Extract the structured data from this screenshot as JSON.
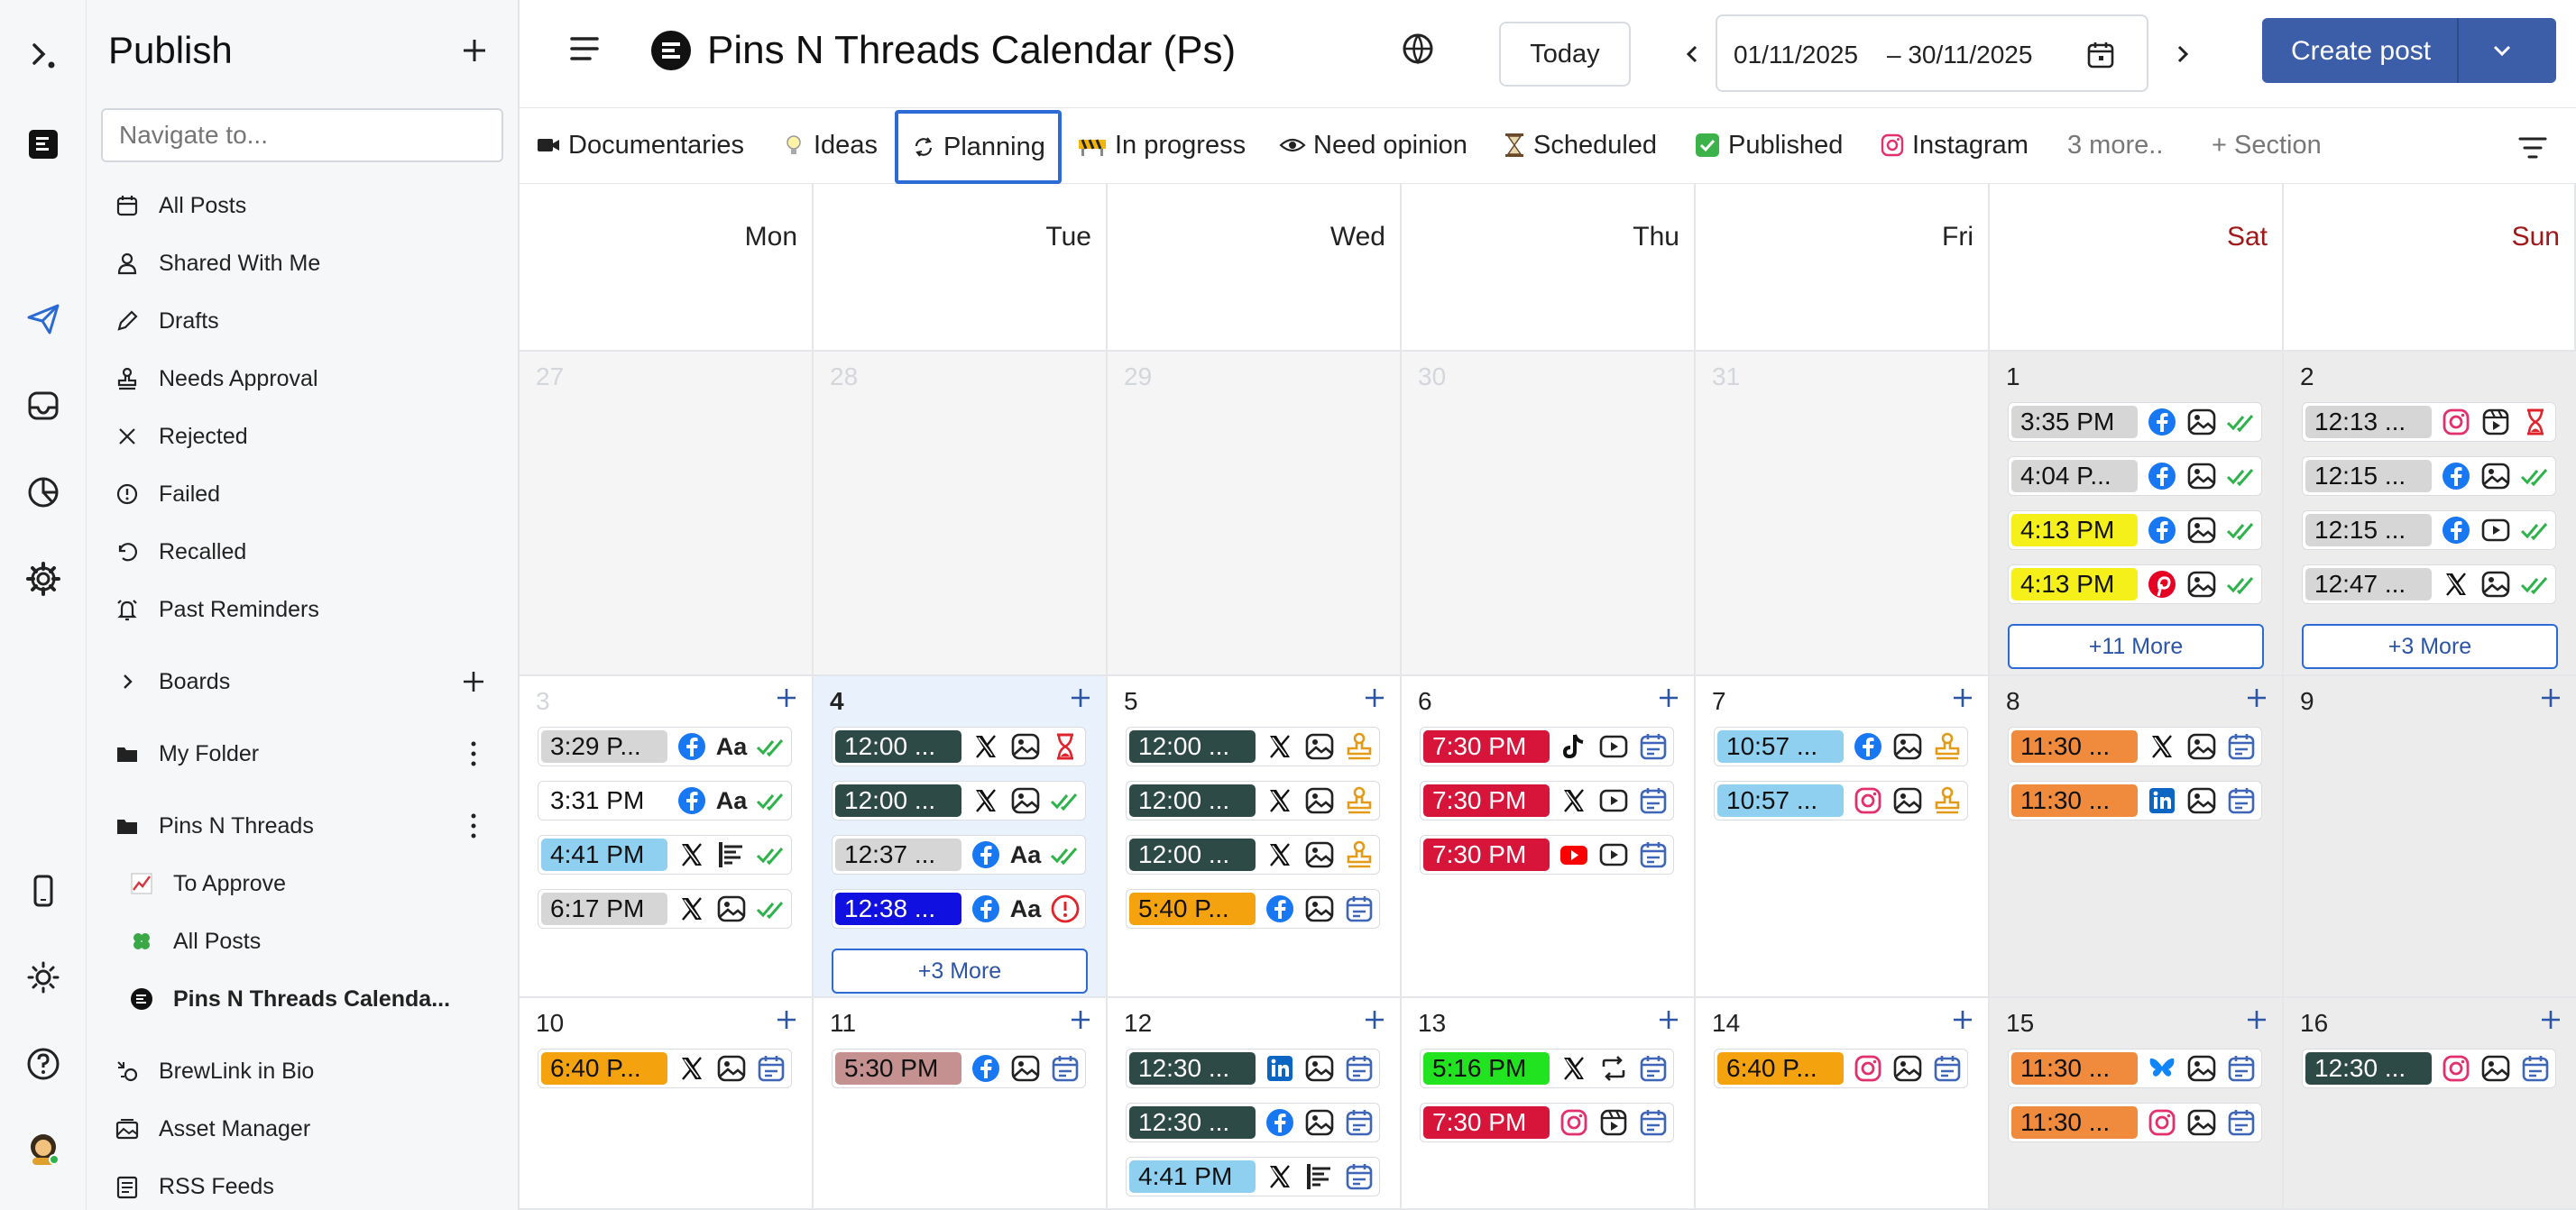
{
  "colors": {
    "accent": "#3c5ea8",
    "tab_active_border": "#2c6bd6",
    "weekend_text": "#a01818",
    "today_bg": "#e8f1fc"
  },
  "sidebar": {
    "title": "Publish",
    "search_placeholder": "Navigate to...",
    "items": [
      {
        "label": "All Posts",
        "icon": "calendar-icon"
      },
      {
        "label": "Shared With Me",
        "icon": "user-icon"
      },
      {
        "label": "Drafts",
        "icon": "pencil-icon"
      },
      {
        "label": "Needs Approval",
        "icon": "stamp-icon"
      },
      {
        "label": "Rejected",
        "icon": "close-icon"
      },
      {
        "label": "Failed",
        "icon": "alert-icon"
      },
      {
        "label": "Recalled",
        "icon": "undo-icon"
      },
      {
        "label": "Past Reminders",
        "icon": "alarm-icon"
      }
    ],
    "boards_label": "Boards",
    "folders": [
      {
        "label": "My Folder"
      },
      {
        "label": "Pins N Threads"
      }
    ],
    "subitems": [
      {
        "label": "To Approve",
        "icon": "chart-emoji-icon"
      },
      {
        "label": "All Posts",
        "icon": "clover-emoji-icon"
      },
      {
        "label": "Pins N Threads Calenda...",
        "icon": "brand-logo-icon"
      }
    ],
    "bottom": [
      {
        "label": "BrewLink in Bio",
        "icon": "link-bio-icon"
      },
      {
        "label": "Asset Manager",
        "icon": "image-icon"
      },
      {
        "label": "RSS Feeds",
        "icon": "rss-icon"
      }
    ]
  },
  "header": {
    "title": "Pins N Threads Calendar (Ps)",
    "today": "Today",
    "date_from": "01/11/2025",
    "date_to": "– 30/11/2025",
    "create": "Create post"
  },
  "tabs": [
    {
      "label": "Documentaries",
      "icon": "video-camera-icon"
    },
    {
      "label": "Ideas",
      "icon": "bulb-icon"
    },
    {
      "label": "Planning",
      "icon": "refresh-icon",
      "active": true
    },
    {
      "label": "In progress",
      "icon": "construction-icon"
    },
    {
      "label": "Need opinion",
      "icon": "eye-icon"
    },
    {
      "label": "Scheduled",
      "icon": "hourglass-icon"
    },
    {
      "label": "Published",
      "icon": "check-box-icon"
    },
    {
      "label": "Instagram",
      "icon": "instagram-icon"
    },
    {
      "label": "3 more..",
      "icon": ""
    },
    {
      "label": "+ Section",
      "icon": ""
    }
  ],
  "calendar": {
    "weekdays": [
      "Mon",
      "Tue",
      "Wed",
      "Thu",
      "Fri",
      "Sat",
      "Sun"
    ],
    "weeks": [
      {
        "days": [
          {
            "num": "27",
            "posts": []
          },
          {
            "num": "28",
            "posts": []
          },
          {
            "num": "29",
            "posts": []
          },
          {
            "num": "30",
            "posts": []
          },
          {
            "num": "31",
            "posts": []
          },
          {
            "num": "1",
            "posts": [
              {
                "time": "3:35 PM",
                "bg": "#d6d6d6",
                "fg": "#111",
                "icons": [
                  "facebook",
                  "image",
                  "check"
                ]
              },
              {
                "time": "4:04 P...",
                "bg": "#d6d6d6",
                "fg": "#111",
                "icons": [
                  "facebook",
                  "image",
                  "check"
                ]
              },
              {
                "time": "4:13 PM",
                "bg": "#f5ef1a",
                "fg": "#111",
                "icons": [
                  "facebook",
                  "image",
                  "check"
                ]
              },
              {
                "time": "4:13 PM",
                "bg": "#f5ef1a",
                "fg": "#111",
                "icons": [
                  "pinterest",
                  "image",
                  "check"
                ]
              }
            ],
            "more": "+11 More"
          },
          {
            "num": "2",
            "posts": [
              {
                "time": "12:13 ...",
                "bg": "#d6d6d6",
                "fg": "#111",
                "icons": [
                  "instagram",
                  "reel",
                  "hourglass"
                ]
              },
              {
                "time": "12:15 ...",
                "bg": "#d6d6d6",
                "fg": "#111",
                "icons": [
                  "facebook",
                  "image",
                  "check"
                ]
              },
              {
                "time": "12:15 ...",
                "bg": "#d6d6d6",
                "fg": "#111",
                "icons": [
                  "facebook",
                  "video",
                  "check"
                ]
              },
              {
                "time": "12:47 ...",
                "bg": "#d6d6d6",
                "fg": "#111",
                "icons": [
                  "x",
                  "image",
                  "check"
                ]
              }
            ],
            "more": "+3 More"
          }
        ]
      },
      {
        "days": [
          {
            "num": "3",
            "posts": [
              {
                "time": "3:29 P...",
                "bg": "#d6d6d6",
                "fg": "#111",
                "icons": [
                  "facebook",
                  "text",
                  "check"
                ]
              },
              {
                "time": "3:31 PM",
                "bg": "#ffffff",
                "fg": "#111",
                "icons": [
                  "facebook",
                  "text",
                  "check"
                ]
              },
              {
                "time": "4:41 PM",
                "bg": "#8fd0f0",
                "fg": "#111",
                "icons": [
                  "x",
                  "thread",
                  "check"
                ]
              },
              {
                "time": "6:17 PM",
                "bg": "#d6d6d6",
                "fg": "#111",
                "icons": [
                  "x",
                  "image",
                  "check"
                ]
              }
            ]
          },
          {
            "num": "4",
            "today": true,
            "posts": [
              {
                "time": "12:00 ...",
                "bg": "#2e4a47",
                "fg": "#fff",
                "icons": [
                  "x",
                  "image",
                  "hourglass"
                ]
              },
              {
                "time": "12:00 ...",
                "bg": "#2e4a47",
                "fg": "#fff",
                "icons": [
                  "x",
                  "image",
                  "check"
                ]
              },
              {
                "time": "12:37 ...",
                "bg": "#d6d6d6",
                "fg": "#111",
                "icons": [
                  "facebook",
                  "text",
                  "check"
                ]
              },
              {
                "time": "12:38 ...",
                "bg": "#1010e0",
                "fg": "#fff",
                "icons": [
                  "facebook",
                  "text",
                  "failed"
                ]
              }
            ],
            "more": "+3 More"
          },
          {
            "num": "5",
            "posts": [
              {
                "time": "12:00 ...",
                "bg": "#2e4a47",
                "fg": "#fff",
                "icons": [
                  "x",
                  "image",
                  "stamp"
                ]
              },
              {
                "time": "12:00 ...",
                "bg": "#2e4a47",
                "fg": "#fff",
                "icons": [
                  "x",
                  "image",
                  "stamp"
                ]
              },
              {
                "time": "12:00 ...",
                "bg": "#2e4a47",
                "fg": "#fff",
                "icons": [
                  "x",
                  "image",
                  "stamp"
                ]
              },
              {
                "time": "5:40 P...",
                "bg": "#f5a20f",
                "fg": "#111",
                "icons": [
                  "facebook",
                  "image",
                  "calendar"
                ]
              }
            ]
          },
          {
            "num": "6",
            "posts": [
              {
                "time": "7:30 PM",
                "bg": "#d7153a",
                "fg": "#fff",
                "icons": [
                  "tiktok",
                  "video",
                  "calendar"
                ]
              },
              {
                "time": "7:30 PM",
                "bg": "#d7153a",
                "fg": "#fff",
                "icons": [
                  "x",
                  "video",
                  "calendar"
                ]
              },
              {
                "time": "7:30 PM",
                "bg": "#d7153a",
                "fg": "#fff",
                "icons": [
                  "youtube",
                  "video",
                  "calendar"
                ]
              }
            ]
          },
          {
            "num": "7",
            "posts": [
              {
                "time": "10:57 ...",
                "bg": "#8fd0f0",
                "fg": "#111",
                "icons": [
                  "facebook",
                  "image",
                  "stamp"
                ]
              },
              {
                "time": "10:57 ...",
                "bg": "#8fd0f0",
                "fg": "#111",
                "icons": [
                  "instagram",
                  "image",
                  "stamp"
                ]
              }
            ]
          },
          {
            "num": "8",
            "posts": [
              {
                "time": "11:30 ...",
                "bg": "#f08a3c",
                "fg": "#111",
                "icons": [
                  "x",
                  "image",
                  "calendar"
                ]
              },
              {
                "time": "11:30 ...",
                "bg": "#f08a3c",
                "fg": "#111",
                "icons": [
                  "linkedin",
                  "image",
                  "calendar"
                ]
              }
            ]
          },
          {
            "num": "9",
            "posts": []
          }
        ]
      },
      {
        "days": [
          {
            "num": "10",
            "posts": [
              {
                "time": "6:40 P...",
                "bg": "#f5a20f",
                "fg": "#111",
                "icons": [
                  "x",
                  "image",
                  "calendar"
                ]
              }
            ]
          },
          {
            "num": "11",
            "posts": [
              {
                "time": "5:30 PM",
                "bg": "#c49090",
                "fg": "#111",
                "icons": [
                  "facebook",
                  "image",
                  "calendar"
                ]
              }
            ]
          },
          {
            "num": "12",
            "posts": [
              {
                "time": "12:30 ...",
                "bg": "#2e4a47",
                "fg": "#fff",
                "icons": [
                  "linkedin",
                  "image",
                  "calendar"
                ]
              },
              {
                "time": "12:30 ...",
                "bg": "#2e4a47",
                "fg": "#fff",
                "icons": [
                  "facebook",
                  "image",
                  "calendar"
                ]
              },
              {
                "time": "4:41 PM",
                "bg": "#8fd0f0",
                "fg": "#111",
                "icons": [
                  "x",
                  "thread",
                  "calendar"
                ]
              }
            ]
          },
          {
            "num": "13",
            "posts": [
              {
                "time": "5:16 PM",
                "bg": "#22e31f",
                "fg": "#111",
                "icons": [
                  "x",
                  "repost",
                  "calendar"
                ]
              },
              {
                "time": "7:30 PM",
                "bg": "#d7153a",
                "fg": "#fff",
                "icons": [
                  "instagram",
                  "reel",
                  "calendar"
                ]
              }
            ]
          },
          {
            "num": "14",
            "posts": [
              {
                "time": "6:40 P...",
                "bg": "#f5a20f",
                "fg": "#111",
                "icons": [
                  "instagram",
                  "image",
                  "calendar"
                ]
              }
            ]
          },
          {
            "num": "15",
            "posts": [
              {
                "time": "11:30 ...",
                "bg": "#f08a3c",
                "fg": "#111",
                "icons": [
                  "bluesky",
                  "image",
                  "calendar"
                ]
              },
              {
                "time": "11:30 ...",
                "bg": "#f08a3c",
                "fg": "#111",
                "icons": [
                  "instagram",
                  "image",
                  "calendar"
                ]
              }
            ]
          },
          {
            "num": "16",
            "posts": [
              {
                "time": "12:30 ...",
                "bg": "#2e4a47",
                "fg": "#fff",
                "icons": [
                  "instagram",
                  "image",
                  "calendar"
                ]
              }
            ]
          }
        ]
      }
    ]
  }
}
